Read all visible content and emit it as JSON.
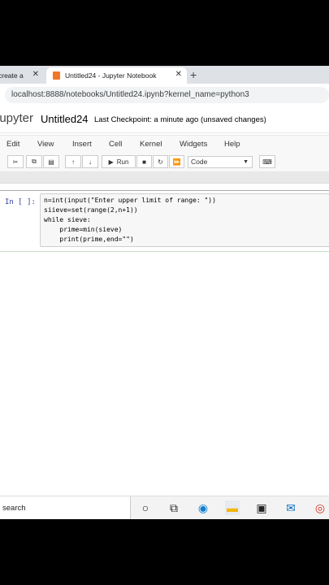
{
  "browser": {
    "tabs": [
      {
        "label": "create a",
        "active": false
      },
      {
        "label": "Untitled24 - Jupyter Notebook",
        "active": true
      }
    ],
    "url": "localhost:8888/notebooks/Untitled24.ipynb?kernel_name=python3"
  },
  "jupyter": {
    "logo": "jupyter",
    "notebook_name": "Untitled24",
    "checkpoint": "Last Checkpoint: a minute ago  (unsaved changes)",
    "menu": [
      "Edit",
      "View",
      "Insert",
      "Cell",
      "Kernel",
      "Widgets",
      "Help"
    ],
    "toolbar": {
      "run_label": "Run",
      "cell_type": "Code"
    }
  },
  "cell": {
    "prompt": "In [ ]:",
    "lines": [
      "n=int(input(\"Enter upper limit of range: \"))",
      "siieve=set(range(2,n+1))",
      "while sieve:",
      "    prime=min(sieve)",
      "    print(prime,end=\"\")"
    ]
  },
  "taskbar": {
    "search_text": "search",
    "icons": [
      "cortana-icon",
      "task-view-icon",
      "edge-icon",
      "file-explorer-icon",
      "store-icon",
      "mail-icon",
      "chrome-icon"
    ]
  }
}
